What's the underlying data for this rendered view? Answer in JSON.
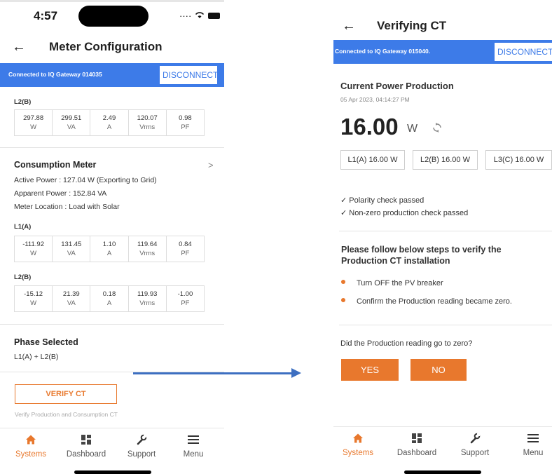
{
  "left": {
    "status": {
      "time": "4:57"
    },
    "title": "Meter Configuration",
    "banner": {
      "text": "Connected to IQ Gateway 014035",
      "disconnect": "DISCONNECT"
    },
    "top_reading": {
      "label": "L2(B)",
      "cells": [
        {
          "value": "297.88",
          "unit": "W"
        },
        {
          "value": "299.51",
          "unit": "VA"
        },
        {
          "value": "2.49",
          "unit": "A"
        },
        {
          "value": "120.07",
          "unit": "Vrms"
        },
        {
          "value": "0.98",
          "unit": "PF"
        }
      ]
    },
    "consumption": {
      "title": "Consumption Meter",
      "active_power": "Active Power : 127.04 W (Exporting to Grid)",
      "apparent_power": "Apparent Power : 152.84 VA",
      "location": "Meter Location : Load with Solar",
      "l1": {
        "label": "L1(A)",
        "cells": [
          {
            "value": "-111.92",
            "unit": "W"
          },
          {
            "value": "131.45",
            "unit": "VA"
          },
          {
            "value": "1.10",
            "unit": "A"
          },
          {
            "value": "119.64",
            "unit": "Vrms"
          },
          {
            "value": "0.84",
            "unit": "PF"
          }
        ]
      },
      "l2": {
        "label": "L2(B)",
        "cells": [
          {
            "value": "-15.12",
            "unit": "W"
          },
          {
            "value": "21.39",
            "unit": "VA"
          },
          {
            "value": "0.18",
            "unit": "A"
          },
          {
            "value": "119.93",
            "unit": "Vrms"
          },
          {
            "value": "-1.00",
            "unit": "PF"
          }
        ]
      }
    },
    "phase": {
      "title": "Phase Selected",
      "value": "L1(A) + L2(B)"
    },
    "verify": {
      "button": "VERIFY CT",
      "hint": "Verify Production and Consumption CT"
    }
  },
  "right": {
    "title": "Verifying CT",
    "banner": {
      "text": "Connected to IQ Gateway 015040.",
      "disconnect": "DISCONNECT"
    },
    "production": {
      "title": "Current Power Production",
      "timestamp": "05 Apr 2023, 04:14:27 PM",
      "value": "16.00",
      "unit": "W",
      "phases": [
        "L1(A) 16.00 W",
        "L2(B) 16.00 W",
        "L3(C) 16.00 W"
      ]
    },
    "checks": [
      "Polarity check passed",
      "Non-zero production check passed"
    ],
    "steps": {
      "title": "Please follow below steps to verify the Production CT installation",
      "items": [
        "Turn OFF the PV breaker",
        "Confirm the Production reading became zero."
      ]
    },
    "question": "Did the Production reading go to zero?",
    "yes": "YES",
    "no": "NO"
  },
  "tabs": [
    {
      "label": "Systems",
      "icon": "home-icon"
    },
    {
      "label": "Dashboard",
      "icon": "dashboard-icon"
    },
    {
      "label": "Support",
      "icon": "wrench-icon"
    },
    {
      "label": "Menu",
      "icon": "menu-icon"
    }
  ],
  "colors": {
    "accent": "#e8782d",
    "banner": "#3d7be8",
    "arrow": "#3d6fc1"
  }
}
